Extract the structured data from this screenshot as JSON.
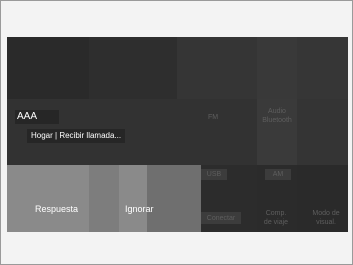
{
  "call": {
    "caller_name": "AAA",
    "caller_info": "Hogar | Recibir llamada...",
    "answer_label": "Respuesta",
    "ignore_label": "Ignorar"
  },
  "menu": {
    "fm": "FM",
    "audio_bt_line1": "Audio",
    "audio_bt_line2": "Bluetooth",
    "usb": "USB",
    "am": "AM",
    "connect": "Conectar",
    "trip_line1": "Comp.",
    "trip_line2": "de viaje",
    "display_line1": "Modo de",
    "display_line2": "visual."
  }
}
